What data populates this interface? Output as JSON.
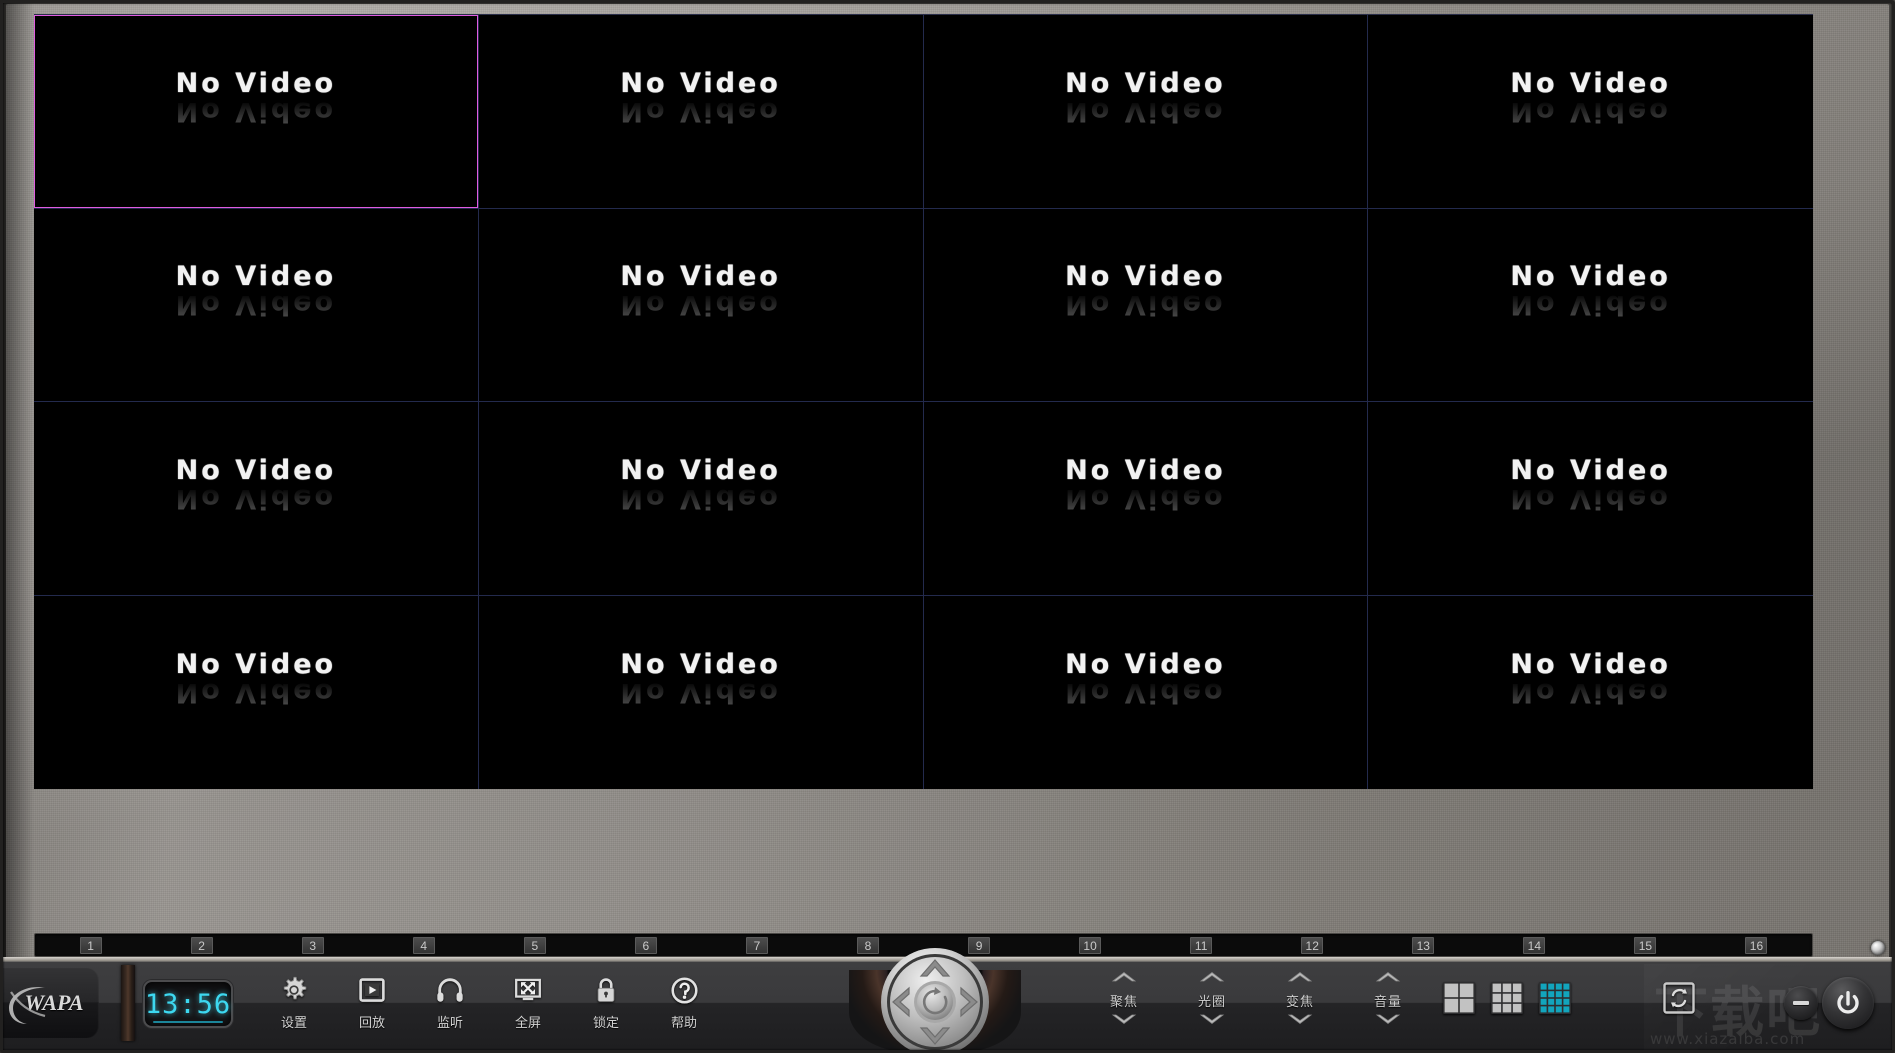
{
  "app": {
    "brand": "WAPA",
    "clock": "13:56"
  },
  "video_wall": {
    "layout": "4x4",
    "rows": 4,
    "cols": 4,
    "selected_index": 0,
    "no_video_label": "No Video",
    "selection_color": "#e05ce0",
    "grid_line_color": "#232a4d",
    "cells": [
      {
        "label": "No Video"
      },
      {
        "label": "No Video"
      },
      {
        "label": "No Video"
      },
      {
        "label": "No Video"
      },
      {
        "label": "No Video"
      },
      {
        "label": "No Video"
      },
      {
        "label": "No Video"
      },
      {
        "label": "No Video"
      },
      {
        "label": "No Video"
      },
      {
        "label": "No Video"
      },
      {
        "label": "No Video"
      },
      {
        "label": "No Video"
      },
      {
        "label": "No Video"
      },
      {
        "label": "No Video"
      },
      {
        "label": "No Video"
      },
      {
        "label": "No Video"
      }
    ]
  },
  "channel_strip": {
    "channels": [
      "1",
      "2",
      "3",
      "4",
      "5",
      "6",
      "7",
      "8",
      "9",
      "10",
      "11",
      "12",
      "13",
      "14",
      "15",
      "16"
    ]
  },
  "toolbar": {
    "buttons": [
      {
        "label": "设置",
        "icon": "gear-icon",
        "name": "settings"
      },
      {
        "label": "回放",
        "icon": "playback-icon",
        "name": "playback"
      },
      {
        "label": "监听",
        "icon": "headphone-icon",
        "name": "audio-monitor"
      },
      {
        "label": "全屏",
        "icon": "fullscreen-icon",
        "name": "fullscreen"
      },
      {
        "label": "锁定",
        "icon": "lock-icon",
        "name": "lock"
      },
      {
        "label": "帮助",
        "icon": "help-icon",
        "name": "help"
      }
    ],
    "spinners": [
      {
        "label": "聚焦",
        "name": "focus"
      },
      {
        "label": "光圈",
        "name": "iris"
      },
      {
        "label": "变焦",
        "name": "zoom"
      },
      {
        "label": "音量",
        "name": "volume"
      }
    ],
    "layouts": [
      {
        "name": "layout-2x2",
        "cells": 2,
        "active": false
      },
      {
        "name": "layout-3x3",
        "cells": 3,
        "active": false
      },
      {
        "name": "layout-4x4",
        "cells": 4,
        "active": true
      }
    ],
    "active_layout_color": "#12a5bd",
    "cycle_label": "cycle-icon",
    "minimize_label": "minimize-icon",
    "power_label": "power-icon",
    "ptz_label": "ptz-joystick"
  },
  "watermark": {
    "text": "下载吧",
    "url": "www.xiazaiba.com"
  }
}
